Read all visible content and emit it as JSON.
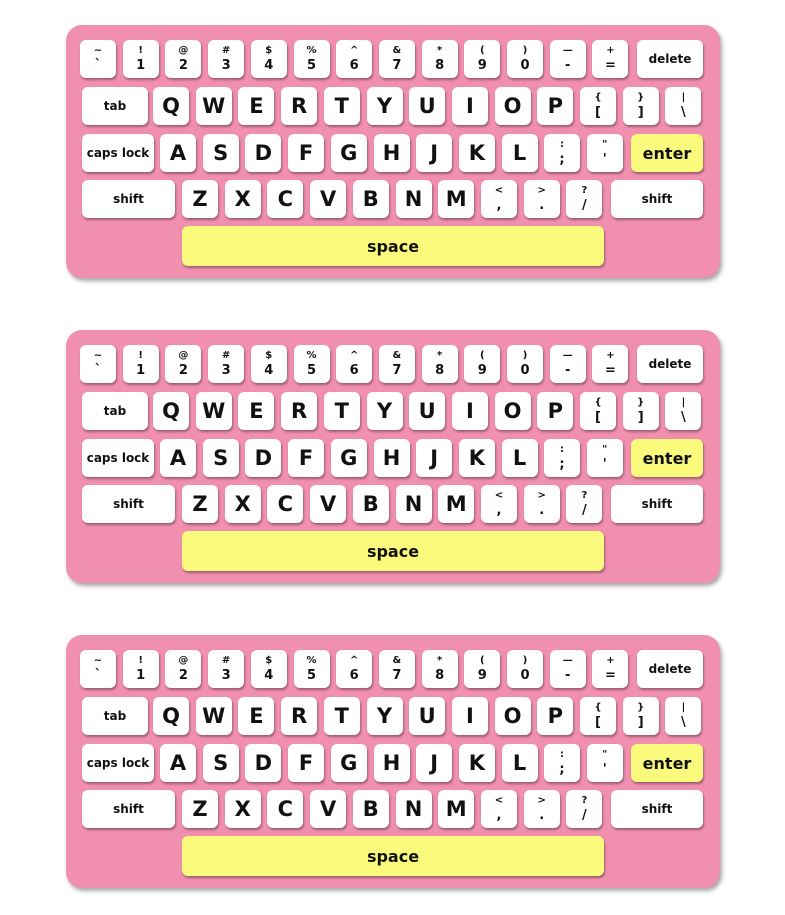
{
  "colors": {
    "keyboard_body": "#f08fae",
    "key_face": "#ffffff",
    "highlight_key": "#fafa7c",
    "legend_text": "#111111"
  },
  "keyboards": [
    {
      "id": "keyboard-1"
    },
    {
      "id": "keyboard-2"
    },
    {
      "id": "keyboard-3"
    }
  ],
  "rows": {
    "number": [
      {
        "id": "tilde",
        "top": "~",
        "bottom": "`"
      },
      {
        "id": "1",
        "top": "!",
        "bottom": "1"
      },
      {
        "id": "2",
        "top": "@",
        "bottom": "2"
      },
      {
        "id": "3",
        "top": "#",
        "bottom": "3"
      },
      {
        "id": "4",
        "top": "$",
        "bottom": "4"
      },
      {
        "id": "5",
        "top": "%",
        "bottom": "5"
      },
      {
        "id": "6",
        "top": "^",
        "bottom": "6"
      },
      {
        "id": "7",
        "top": "&",
        "bottom": "7"
      },
      {
        "id": "8",
        "top": "*",
        "bottom": "8"
      },
      {
        "id": "9",
        "top": "(",
        "bottom": "9"
      },
      {
        "id": "0",
        "top": ")",
        "bottom": "0"
      },
      {
        "id": "minus",
        "top": "—",
        "bottom": "-"
      },
      {
        "id": "equals",
        "top": "+",
        "bottom": "="
      }
    ],
    "top_letters": [
      "Q",
      "W",
      "E",
      "R",
      "T",
      "Y",
      "U",
      "I",
      "O",
      "P"
    ],
    "top_symbols": [
      {
        "id": "bracket-left",
        "top": "{",
        "bottom": "["
      },
      {
        "id": "bracket-right",
        "top": "}",
        "bottom": "]"
      },
      {
        "id": "backslash",
        "top": "|",
        "bottom": "\\"
      }
    ],
    "home_letters": [
      "A",
      "S",
      "D",
      "F",
      "G",
      "H",
      "J",
      "K",
      "L"
    ],
    "home_symbols": [
      {
        "id": "semicolon",
        "top": ":",
        "bottom": ";"
      },
      {
        "id": "quote",
        "top": "\"",
        "bottom": "'"
      }
    ],
    "bottom_letters": [
      "Z",
      "X",
      "C",
      "V",
      "B",
      "N",
      "M"
    ],
    "bottom_symbols": [
      {
        "id": "comma",
        "top": "<",
        "bottom": ","
      },
      {
        "id": "period",
        "top": ">",
        "bottom": "."
      },
      {
        "id": "slash",
        "top": "?",
        "bottom": "/"
      }
    ]
  },
  "labels": {
    "delete": "delete",
    "tab": "tab",
    "caps_lock": "caps lock",
    "enter": "enter",
    "shift": "shift",
    "space": "space"
  }
}
